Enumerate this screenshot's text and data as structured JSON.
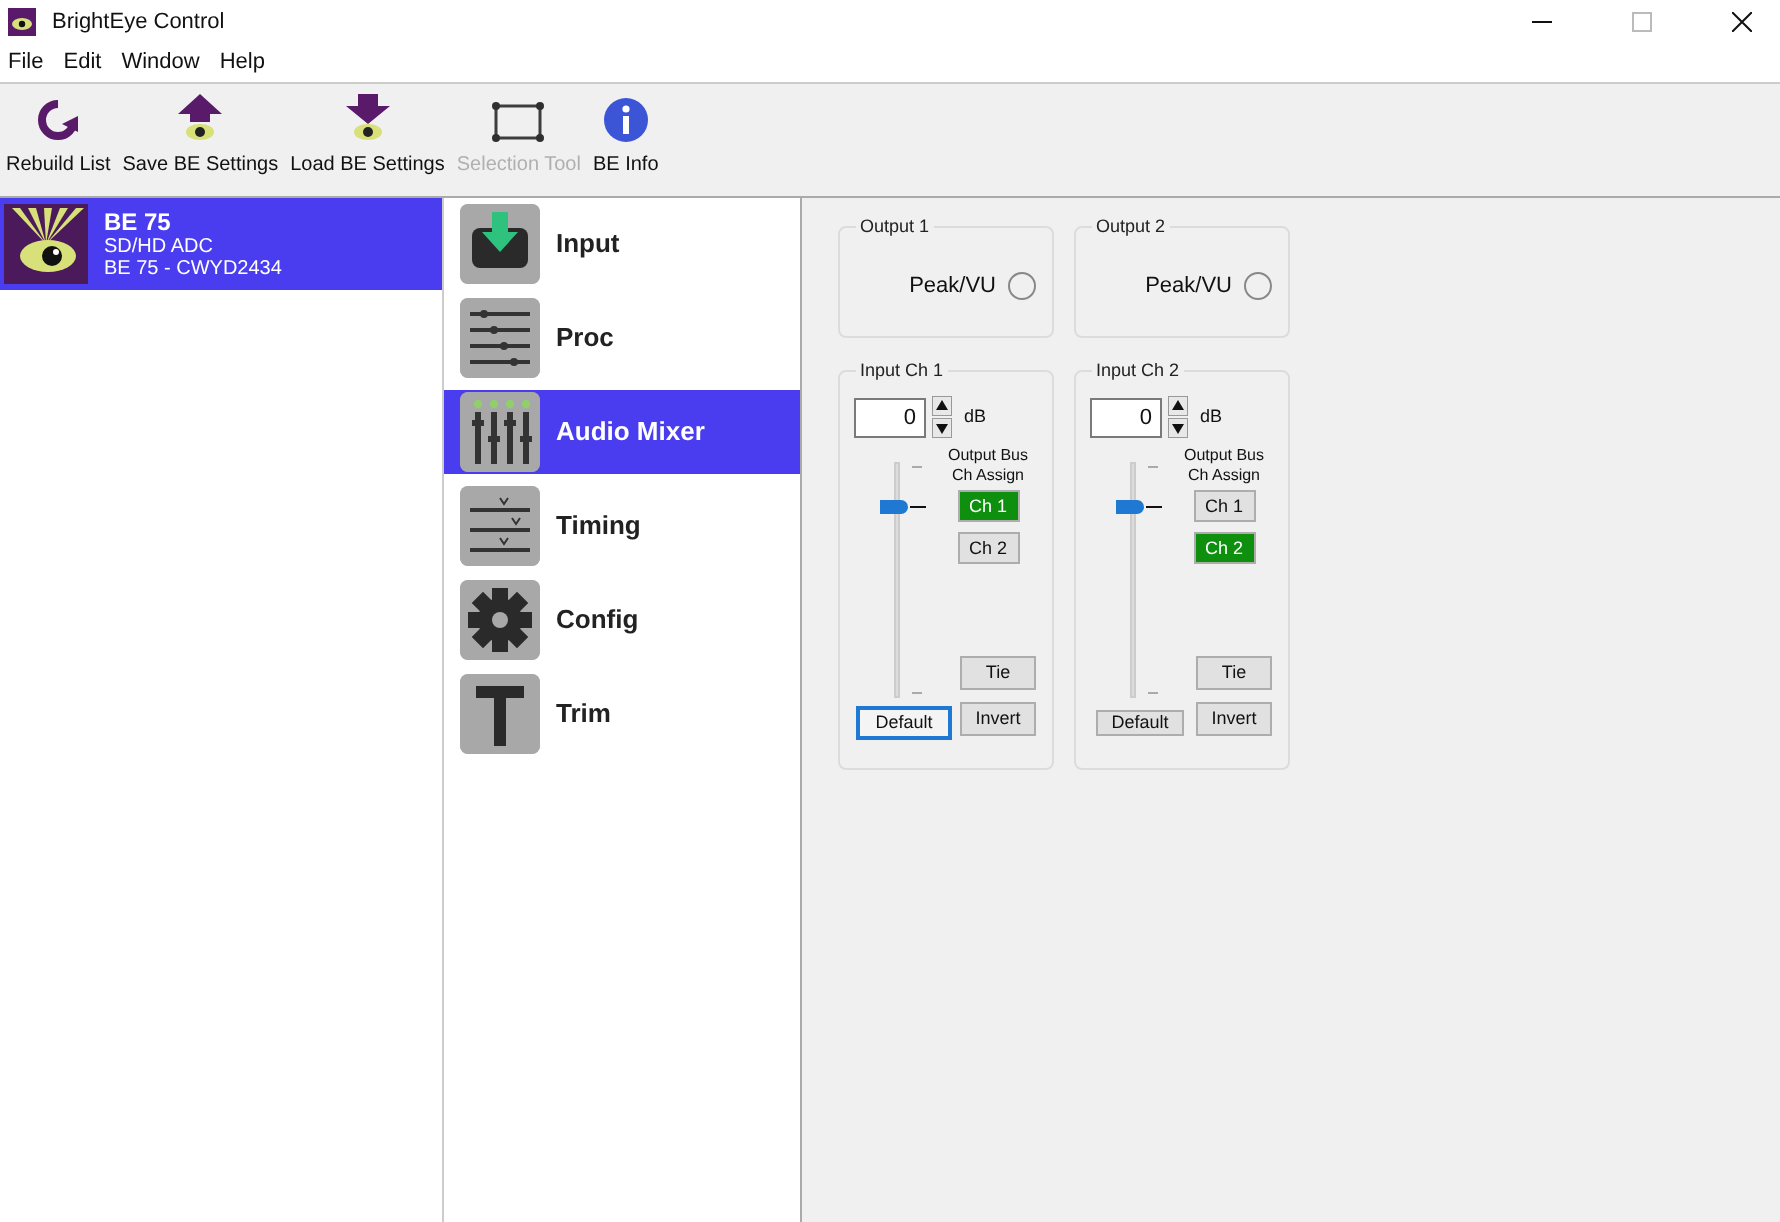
{
  "window": {
    "title": "BrightEye Control"
  },
  "menu": [
    "File",
    "Edit",
    "Window",
    "Help"
  ],
  "toolbar": [
    {
      "kind": "rebuild",
      "label": "Rebuild List",
      "disabled": false
    },
    {
      "kind": "save",
      "label": "Save BE Settings",
      "disabled": false
    },
    {
      "kind": "load",
      "label": "Load BE Settings",
      "disabled": false
    },
    {
      "kind": "selection",
      "label": "Selection Tool",
      "disabled": true
    },
    {
      "kind": "info",
      "label": "BE Info",
      "disabled": false
    }
  ],
  "devices": [
    {
      "name": "BE 75",
      "type": "SD/HD ADC",
      "id": "BE 75 - CWYD2434",
      "selected": true
    }
  ],
  "nav": [
    {
      "kind": "input",
      "label": "Input",
      "selected": false
    },
    {
      "kind": "proc",
      "label": "Proc",
      "selected": false
    },
    {
      "kind": "mixer",
      "label": "Audio Mixer",
      "selected": true
    },
    {
      "kind": "timing",
      "label": "Timing",
      "selected": false
    },
    {
      "kind": "config",
      "label": "Config",
      "selected": false
    },
    {
      "kind": "trim",
      "label": "Trim",
      "selected": false
    }
  ],
  "outputs": [
    {
      "title": "Output 1",
      "meter_label": "Peak/VU",
      "on": false
    },
    {
      "title": "Output 2",
      "meter_label": "Peak/VU",
      "on": false
    }
  ],
  "inputs": [
    {
      "title": "Input Ch 1",
      "gain": "0",
      "unit": "dB",
      "level": 0.83,
      "assign_label": "Output Bus Ch Assign",
      "assign": [
        {
          "label": "Ch 1",
          "selected": true
        },
        {
          "label": "Ch 2",
          "selected": false
        }
      ],
      "tie": "Tie",
      "invert": "Invert",
      "default": "Default",
      "default_focused": true
    },
    {
      "title": "Input Ch 2",
      "gain": "0",
      "unit": "dB",
      "level": 0.83,
      "assign_label": "Output Bus Ch Assign",
      "assign": [
        {
          "label": "Ch 1",
          "selected": false
        },
        {
          "label": "Ch 2",
          "selected": true
        }
      ],
      "tie": "Tie",
      "invert": "Invert",
      "default": "Default",
      "default_focused": false
    }
  ]
}
